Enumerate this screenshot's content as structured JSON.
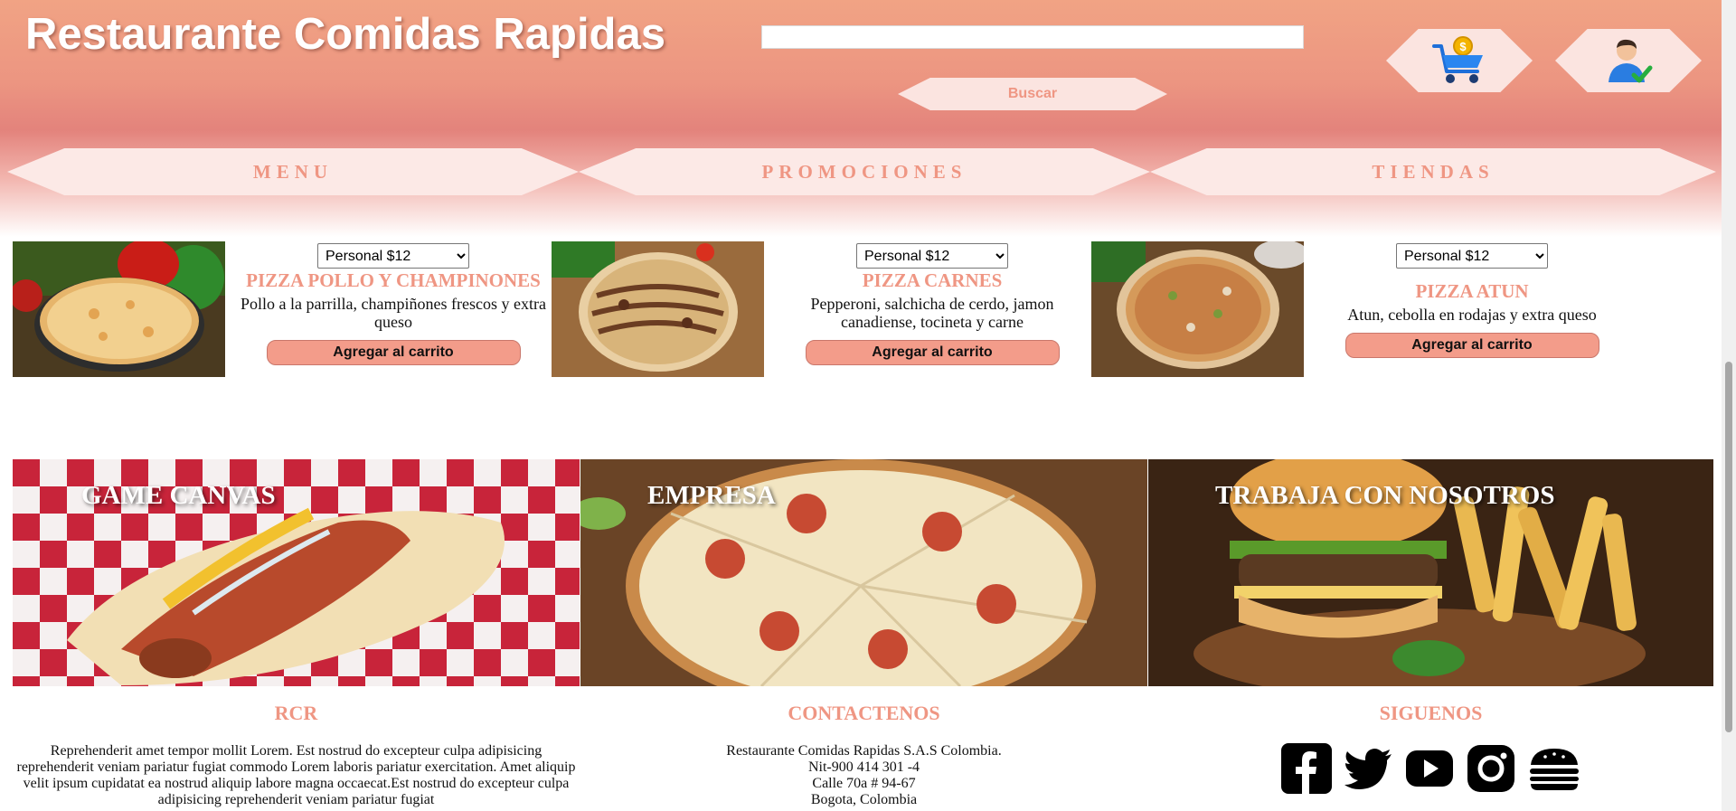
{
  "header": {
    "title": "Restaurante Comidas Rapidas",
    "search": {
      "value": "",
      "placeholder": "",
      "button_label": "Buscar"
    },
    "cart_icon": "shopping-cart-icon",
    "user_icon": "user-check-icon"
  },
  "nav": {
    "tabs": [
      {
        "label": "MENU"
      },
      {
        "label": "PROMOCIONES"
      },
      {
        "label": "TIENDAS"
      }
    ]
  },
  "products": [
    {
      "size_selected": "Personal $12",
      "name": "PIZZA POLLO Y CHAMPINONES",
      "description": "Pollo a la parrilla, champiñones frescos y extra queso",
      "button_label": "Agregar al carrito"
    },
    {
      "size_selected": "Personal $12",
      "name": "PIZZA CARNES",
      "description": "Pepperoni, salchicha de cerdo, jamon canadiense, tocineta y carne",
      "button_label": "Agregar al carrito"
    },
    {
      "size_selected": "Personal $12",
      "name": "PIZZA ATUN",
      "description": "Atun, cebolla en rodajas y extra queso",
      "button_label": "Agregar al carrito"
    }
  ],
  "banners": [
    {
      "title": "GAME CANVAS"
    },
    {
      "title": "EMPRESA"
    },
    {
      "title": "TRABAJA CON NOSOTROS"
    }
  ],
  "footer": {
    "rcr": {
      "heading": "RCR",
      "text": "Reprehenderit amet tempor mollit Lorem. Est nostrud do excepteur culpa adipisicing reprehenderit veniam pariatur fugiat commodo Lorem laboris pariatur exercitation. Amet aliquip velit ipsum cupidatat ea nostrud aliquip labore magna occaecat.Est nostrud do excepteur culpa adipisicing reprehenderit veniam pariatur fugiat"
    },
    "contact": {
      "heading": "CONTACTENOS",
      "company": "Restaurante Comidas Rapidas S.A.S Colombia.",
      "nit": "Nit-900 414 301 -4",
      "address": "Calle 70a # 94-67",
      "city": "Bogota, Colombia"
    },
    "social": {
      "heading": "SIGUENOS",
      "icons": [
        "facebook-icon",
        "twitter-icon",
        "youtube-icon",
        "instagram-icon",
        "burger-icon"
      ]
    }
  },
  "colors": {
    "accent": "#ef9683",
    "button": "#f39c8a",
    "hex_bg": "#fbe4e0"
  }
}
